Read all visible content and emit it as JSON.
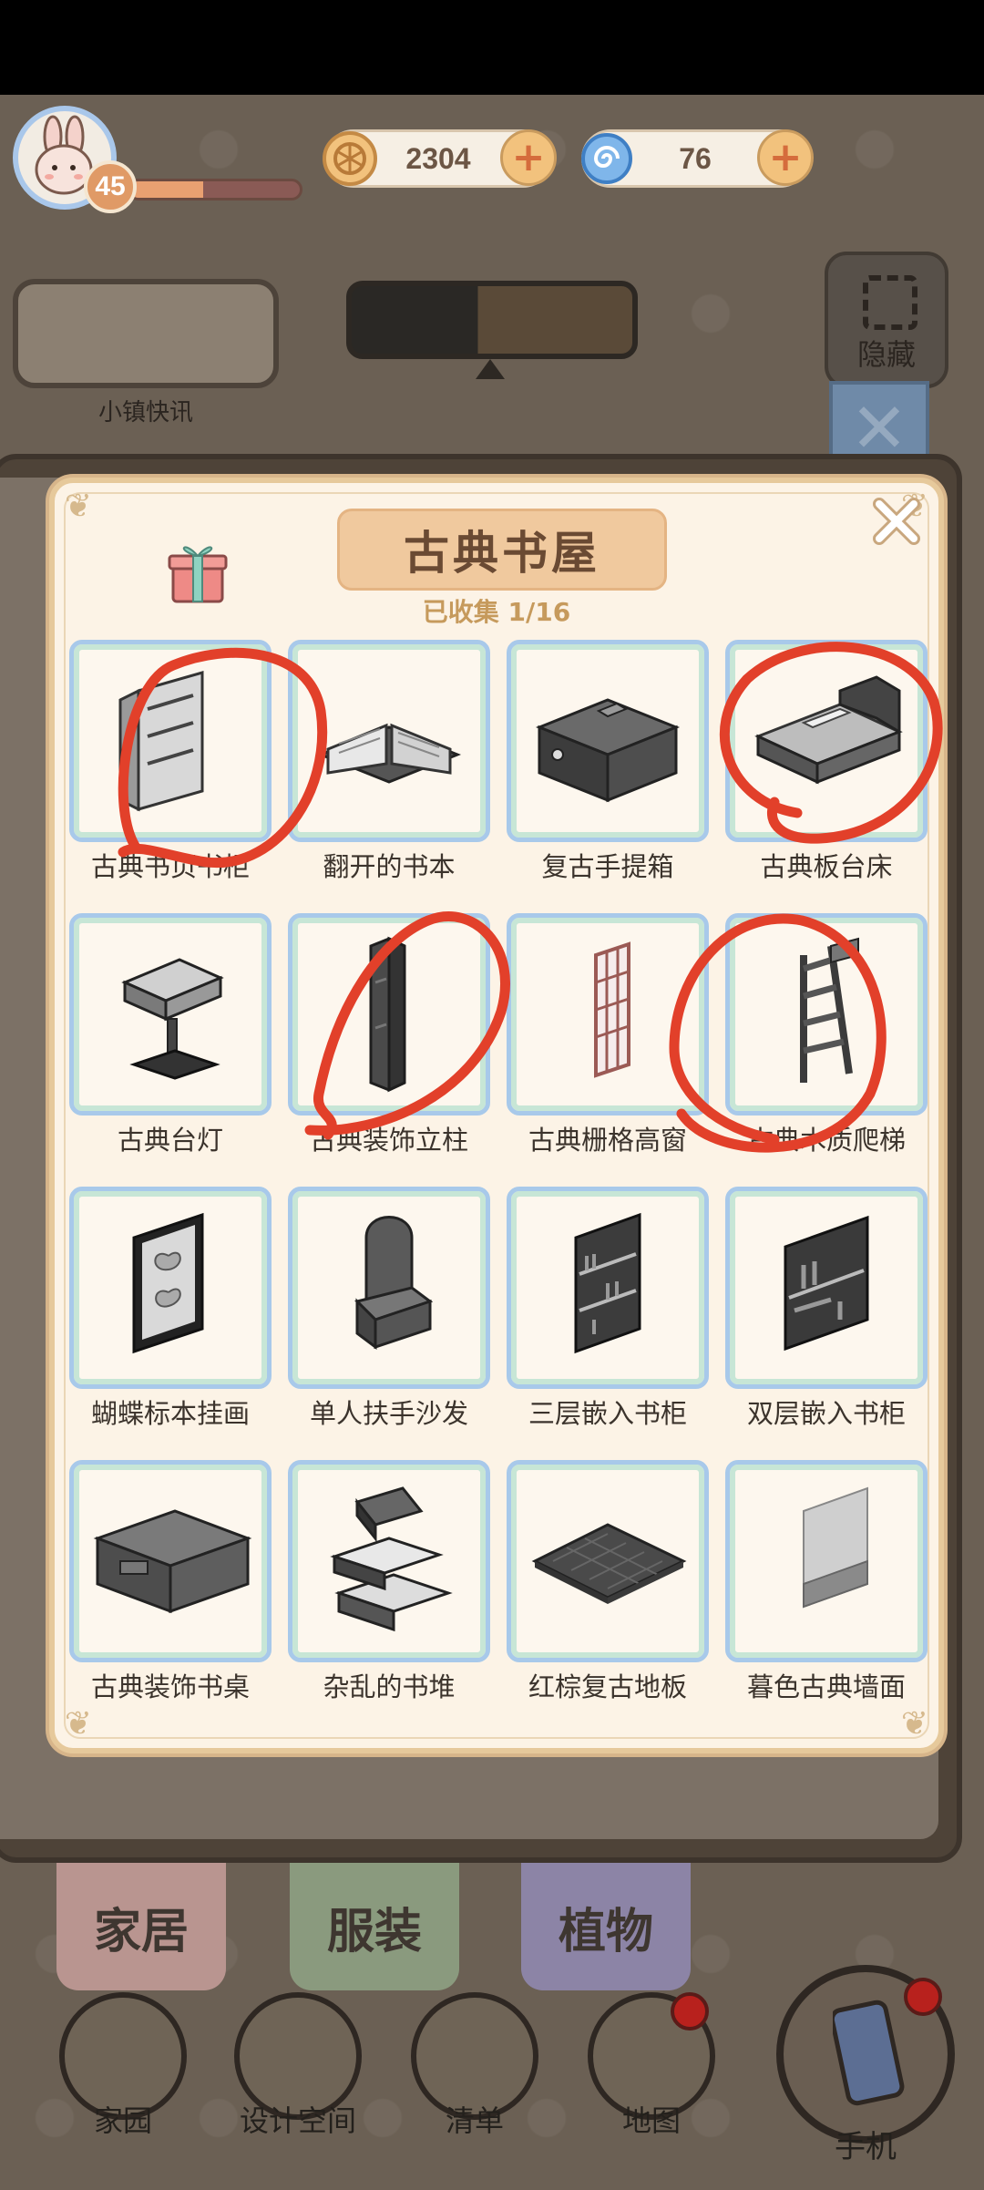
{
  "hud": {
    "level": "45",
    "xp_progress": 0.43,
    "coins": "2304",
    "gems": "76",
    "coin_icon": "coin-icon",
    "gem_icon": "swirl-gem-icon",
    "news_label": "小镇快讯",
    "hide_label": "隐藏"
  },
  "panel": {
    "title": "古典书屋",
    "collected": "已收集 1/16",
    "items": [
      {
        "name": "古典书页书柜",
        "icon": "bookshelf-screen-icon"
      },
      {
        "name": "翻开的书本",
        "icon": "open-book-icon"
      },
      {
        "name": "复古手提箱",
        "icon": "suitcase-icon"
      },
      {
        "name": "古典板台床",
        "icon": "bed-icon"
      },
      {
        "name": "古典台灯",
        "icon": "desk-lamp-icon"
      },
      {
        "name": "古典装饰立柱",
        "icon": "pillar-icon"
      },
      {
        "name": "古典栅格高窗",
        "icon": "tall-window-icon"
      },
      {
        "name": "古典木质爬梯",
        "icon": "ladder-icon"
      },
      {
        "name": "蝴蝶标本挂画",
        "icon": "butterfly-frame-icon"
      },
      {
        "name": "单人扶手沙发",
        "icon": "armchair-icon"
      },
      {
        "name": "三层嵌入书柜",
        "icon": "three-tier-shelf-icon"
      },
      {
        "name": "双层嵌入书柜",
        "icon": "two-tier-shelf-icon"
      },
      {
        "name": "古典装饰书桌",
        "icon": "desk-icon"
      },
      {
        "name": "杂乱的书堆",
        "icon": "book-stack-icon"
      },
      {
        "name": "红棕复古地板",
        "icon": "floor-tile-icon"
      },
      {
        "name": "暮色古典墙面",
        "icon": "wall-panel-icon"
      }
    ]
  },
  "tabs": [
    {
      "label": "家居",
      "color": "#b99590"
    },
    {
      "label": "服装",
      "color": "#8a9a7e"
    },
    {
      "label": "植物",
      "color": "#8c84a6"
    }
  ],
  "nav": [
    {
      "label": "家园",
      "icon": "house-icon"
    },
    {
      "label": "设计空间",
      "icon": "design-ruler-icon"
    },
    {
      "label": "清单",
      "icon": "checklist-icon"
    },
    {
      "label": "地图",
      "icon": "map-pin-icon"
    },
    {
      "label": "手机",
      "icon": "phone-icon"
    }
  ],
  "colors": {
    "annotation_red": "#e2402a",
    "card_border": "#a8c9ea"
  }
}
